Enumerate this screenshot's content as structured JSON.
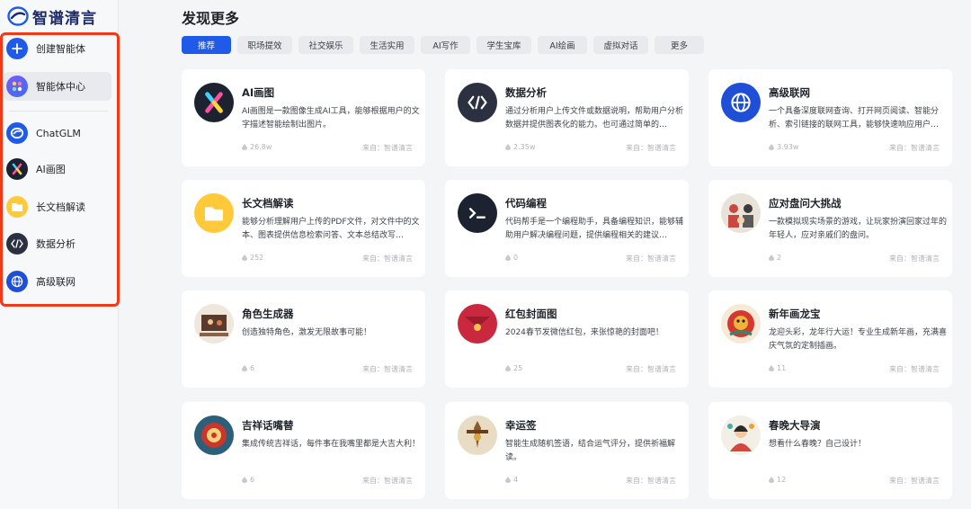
{
  "app": {
    "name": "智谱清言"
  },
  "sidebar": {
    "items": [
      {
        "label": "创建智能体",
        "icon": "plus-icon"
      },
      {
        "label": "智能体中心",
        "icon": "apps-icon"
      },
      {
        "label": "ChatGLM",
        "icon": "chatglm-icon"
      },
      {
        "label": "AI画图",
        "icon": "ai-draw-icon"
      },
      {
        "label": "长文档解读",
        "icon": "folder-icon"
      },
      {
        "label": "数据分析",
        "icon": "code-icon"
      },
      {
        "label": "高级联网",
        "icon": "globe-icon"
      }
    ]
  },
  "main": {
    "title": "发现更多",
    "tabs": [
      "推荐",
      "职场提效",
      "社交娱乐",
      "生活实用",
      "AI写作",
      "学生宝库",
      "AI绘画",
      "虚拟对话",
      "更多"
    ],
    "cards": [
      {
        "title": "AI画图",
        "desc": "AI画图是一款图像生成AI工具，能够根据用户的文字描述智能绘制出图片。",
        "count": "26.8w",
        "source": "来自：智谱清言",
        "icon": "ai-draw-icon"
      },
      {
        "title": "数据分析",
        "desc": "通过分析用户上传文件或数据说明，帮助用户分析数据并提供图表化的能力。也可通过简单的…",
        "count": "2.35w",
        "source": "来自：智谱清言",
        "icon": "code-icon"
      },
      {
        "title": "高级联网",
        "desc": "一个具备深度联网查询、打开网页阅读、智能分析、索引链接的联网工具，能够快速响应用户…",
        "count": "3.93w",
        "source": "来自：智谱清言",
        "icon": "globe-icon"
      },
      {
        "title": "长文档解读",
        "desc": "能够分析理解用户上传的PDF文件，对文件中的文本、图表提供信息检索问答、文本总结改写…",
        "count": "252",
        "source": "来自：智谱清言",
        "icon": "folder-icon"
      },
      {
        "title": "代码编程",
        "desc": "代码帮手是一个编程助手，具备编程知识，能够辅助用户解决编程问题，提供编程相关的建议…",
        "count": "0",
        "source": "来自：智谱清言",
        "icon": "terminal-icon"
      },
      {
        "title": "应对盘问大挑战",
        "desc": "一款模拟现实场景的游戏，让玩家扮演回家过年的年轻人，应对亲戚们的盘问。",
        "count": "2",
        "source": "来自：智谱清言",
        "icon": "family-avatar-icon"
      },
      {
        "title": "角色生成器",
        "desc": "创造独特角色，激发无限故事可能！",
        "count": "6",
        "source": "来自：智谱清言",
        "icon": "character-avatar-icon"
      },
      {
        "title": "红包封面图",
        "desc": "2024春节发微信红包，来张惊艳的封面吧！",
        "count": "25",
        "source": "来自：智谱清言",
        "icon": "red-envelope-icon"
      },
      {
        "title": "新年画龙宝",
        "desc": "龙迎头彩，龙年行大运！专业生成新年画，充满喜庆气氛的定制插画。",
        "count": "11",
        "source": "来自：智谱清言",
        "icon": "dragon-avatar-icon"
      },
      {
        "title": "吉祥话嘴替",
        "desc": "集成传统吉祥话，每件事在我嘴里都是大吉大利！",
        "count": "6",
        "source": "来自：智谱清言",
        "icon": "blessing-avatar-icon"
      },
      {
        "title": "幸运签",
        "desc": "智能生成随机签语，结合运气评分，提供祈福解读。",
        "count": "4",
        "source": "来自：智谱清言",
        "icon": "lucky-sign-icon"
      },
      {
        "title": "春晚大导演",
        "desc": "想看什么春晚？自己设计！",
        "count": "12",
        "source": "来自：智谱清言",
        "icon": "gala-avatar-icon"
      }
    ]
  },
  "colors": {
    "accent": "#1f5ae8",
    "highlight": "#f03a17"
  }
}
